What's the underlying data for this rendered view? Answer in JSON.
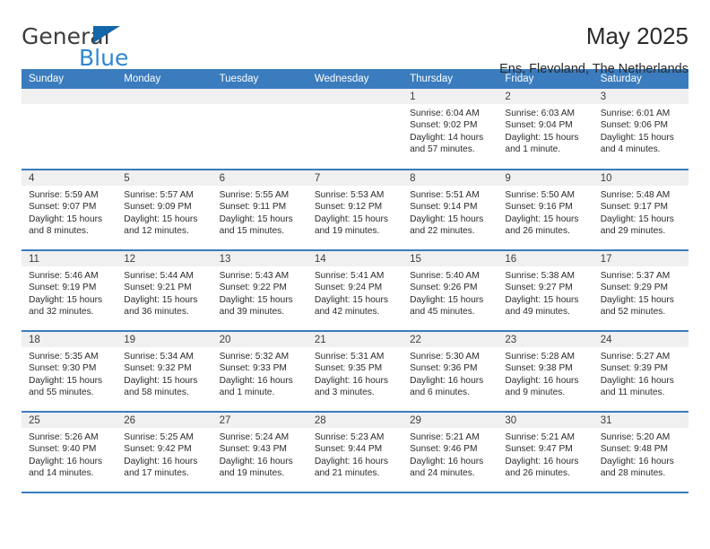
{
  "brand": {
    "name_part1": "General",
    "name_part2": "Blue",
    "triangle_color": "#1566a8",
    "blue_color": "#2f86d0"
  },
  "header": {
    "title": "May 2025",
    "subtitle": "Ens, Flevoland, The Netherlands"
  },
  "theme": {
    "header_blue": "#3a7cbe",
    "band_gray": "#f0f0f0"
  },
  "weekdays": [
    "Sunday",
    "Monday",
    "Tuesday",
    "Wednesday",
    "Thursday",
    "Friday",
    "Saturday"
  ],
  "labels": {
    "sunrise_prefix": "Sunrise: ",
    "sunset_prefix": "Sunset: ",
    "daylight_prefix": "Daylight: "
  },
  "weeks": [
    [
      {
        "day": ""
      },
      {
        "day": ""
      },
      {
        "day": ""
      },
      {
        "day": ""
      },
      {
        "day": "1",
        "sunrise": "Sunrise: 6:04 AM",
        "sunset": "Sunset: 9:02 PM",
        "daylight": "Daylight: 14 hours and 57 minutes."
      },
      {
        "day": "2",
        "sunrise": "Sunrise: 6:03 AM",
        "sunset": "Sunset: 9:04 PM",
        "daylight": "Daylight: 15 hours and 1 minute."
      },
      {
        "day": "3",
        "sunrise": "Sunrise: 6:01 AM",
        "sunset": "Sunset: 9:06 PM",
        "daylight": "Daylight: 15 hours and 4 minutes."
      }
    ],
    [
      {
        "day": "4",
        "sunrise": "Sunrise: 5:59 AM",
        "sunset": "Sunset: 9:07 PM",
        "daylight": "Daylight: 15 hours and 8 minutes."
      },
      {
        "day": "5",
        "sunrise": "Sunrise: 5:57 AM",
        "sunset": "Sunset: 9:09 PM",
        "daylight": "Daylight: 15 hours and 12 minutes."
      },
      {
        "day": "6",
        "sunrise": "Sunrise: 5:55 AM",
        "sunset": "Sunset: 9:11 PM",
        "daylight": "Daylight: 15 hours and 15 minutes."
      },
      {
        "day": "7",
        "sunrise": "Sunrise: 5:53 AM",
        "sunset": "Sunset: 9:12 PM",
        "daylight": "Daylight: 15 hours and 19 minutes."
      },
      {
        "day": "8",
        "sunrise": "Sunrise: 5:51 AM",
        "sunset": "Sunset: 9:14 PM",
        "daylight": "Daylight: 15 hours and 22 minutes."
      },
      {
        "day": "9",
        "sunrise": "Sunrise: 5:50 AM",
        "sunset": "Sunset: 9:16 PM",
        "daylight": "Daylight: 15 hours and 26 minutes."
      },
      {
        "day": "10",
        "sunrise": "Sunrise: 5:48 AM",
        "sunset": "Sunset: 9:17 PM",
        "daylight": "Daylight: 15 hours and 29 minutes."
      }
    ],
    [
      {
        "day": "11",
        "sunrise": "Sunrise: 5:46 AM",
        "sunset": "Sunset: 9:19 PM",
        "daylight": "Daylight: 15 hours and 32 minutes."
      },
      {
        "day": "12",
        "sunrise": "Sunrise: 5:44 AM",
        "sunset": "Sunset: 9:21 PM",
        "daylight": "Daylight: 15 hours and 36 minutes."
      },
      {
        "day": "13",
        "sunrise": "Sunrise: 5:43 AM",
        "sunset": "Sunset: 9:22 PM",
        "daylight": "Daylight: 15 hours and 39 minutes."
      },
      {
        "day": "14",
        "sunrise": "Sunrise: 5:41 AM",
        "sunset": "Sunset: 9:24 PM",
        "daylight": "Daylight: 15 hours and 42 minutes."
      },
      {
        "day": "15",
        "sunrise": "Sunrise: 5:40 AM",
        "sunset": "Sunset: 9:26 PM",
        "daylight": "Daylight: 15 hours and 45 minutes."
      },
      {
        "day": "16",
        "sunrise": "Sunrise: 5:38 AM",
        "sunset": "Sunset: 9:27 PM",
        "daylight": "Daylight: 15 hours and 49 minutes."
      },
      {
        "day": "17",
        "sunrise": "Sunrise: 5:37 AM",
        "sunset": "Sunset: 9:29 PM",
        "daylight": "Daylight: 15 hours and 52 minutes."
      }
    ],
    [
      {
        "day": "18",
        "sunrise": "Sunrise: 5:35 AM",
        "sunset": "Sunset: 9:30 PM",
        "daylight": "Daylight: 15 hours and 55 minutes."
      },
      {
        "day": "19",
        "sunrise": "Sunrise: 5:34 AM",
        "sunset": "Sunset: 9:32 PM",
        "daylight": "Daylight: 15 hours and 58 minutes."
      },
      {
        "day": "20",
        "sunrise": "Sunrise: 5:32 AM",
        "sunset": "Sunset: 9:33 PM",
        "daylight": "Daylight: 16 hours and 1 minute."
      },
      {
        "day": "21",
        "sunrise": "Sunrise: 5:31 AM",
        "sunset": "Sunset: 9:35 PM",
        "daylight": "Daylight: 16 hours and 3 minutes."
      },
      {
        "day": "22",
        "sunrise": "Sunrise: 5:30 AM",
        "sunset": "Sunset: 9:36 PM",
        "daylight": "Daylight: 16 hours and 6 minutes."
      },
      {
        "day": "23",
        "sunrise": "Sunrise: 5:28 AM",
        "sunset": "Sunset: 9:38 PM",
        "daylight": "Daylight: 16 hours and 9 minutes."
      },
      {
        "day": "24",
        "sunrise": "Sunrise: 5:27 AM",
        "sunset": "Sunset: 9:39 PM",
        "daylight": "Daylight: 16 hours and 11 minutes."
      }
    ],
    [
      {
        "day": "25",
        "sunrise": "Sunrise: 5:26 AM",
        "sunset": "Sunset: 9:40 PM",
        "daylight": "Daylight: 16 hours and 14 minutes."
      },
      {
        "day": "26",
        "sunrise": "Sunrise: 5:25 AM",
        "sunset": "Sunset: 9:42 PM",
        "daylight": "Daylight: 16 hours and 17 minutes."
      },
      {
        "day": "27",
        "sunrise": "Sunrise: 5:24 AM",
        "sunset": "Sunset: 9:43 PM",
        "daylight": "Daylight: 16 hours and 19 minutes."
      },
      {
        "day": "28",
        "sunrise": "Sunrise: 5:23 AM",
        "sunset": "Sunset: 9:44 PM",
        "daylight": "Daylight: 16 hours and 21 minutes."
      },
      {
        "day": "29",
        "sunrise": "Sunrise: 5:21 AM",
        "sunset": "Sunset: 9:46 PM",
        "daylight": "Daylight: 16 hours and 24 minutes."
      },
      {
        "day": "30",
        "sunrise": "Sunrise: 5:21 AM",
        "sunset": "Sunset: 9:47 PM",
        "daylight": "Daylight: 16 hours and 26 minutes."
      },
      {
        "day": "31",
        "sunrise": "Sunrise: 5:20 AM",
        "sunset": "Sunset: 9:48 PM",
        "daylight": "Daylight: 16 hours and 28 minutes."
      }
    ]
  ]
}
